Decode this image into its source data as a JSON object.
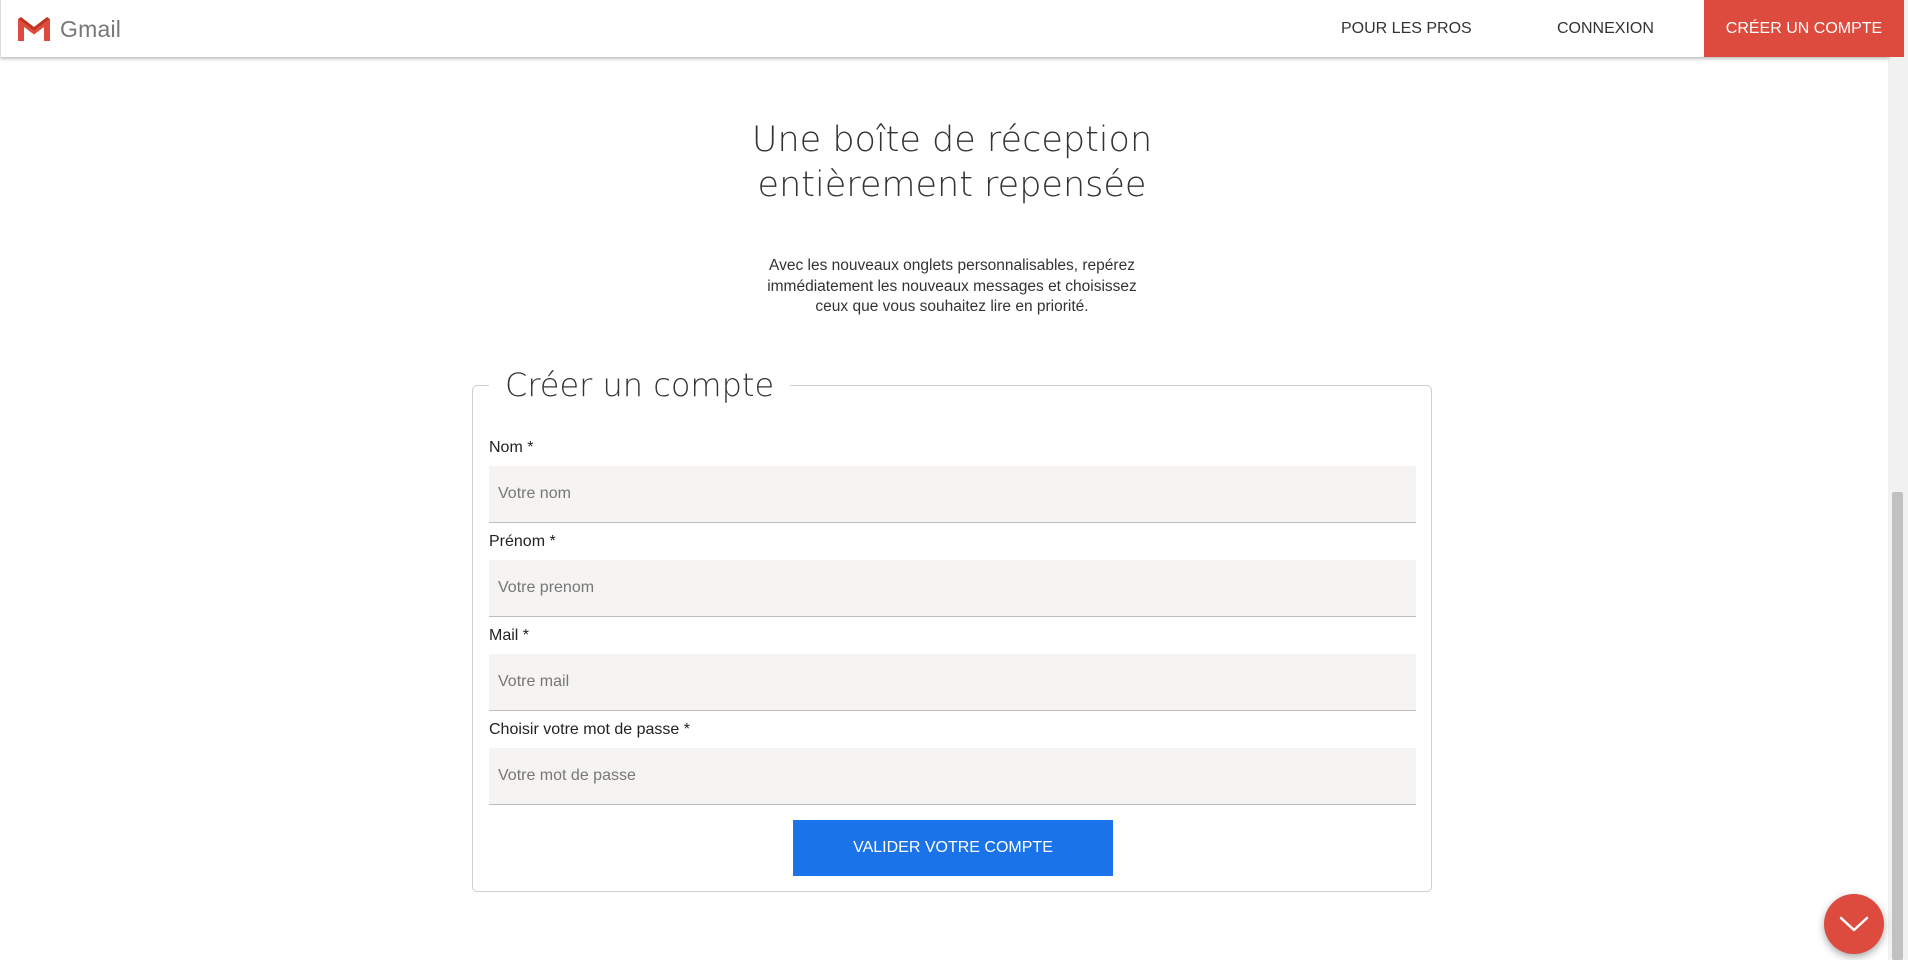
{
  "header": {
    "brand": "Gmail",
    "nav": {
      "pros": "POUR LES PROS",
      "connexion": "CONNEXION",
      "create": "CRÉER UN COMPTE"
    },
    "accent_color": "#dd4b3e"
  },
  "hero": {
    "title_line1": "Une boîte de réception",
    "title_line2": "entièrement repensée",
    "desc_line1": "Avec les nouveaux onglets personnalisables, repérez",
    "desc_line2": "immédiatement les nouveaux messages et choisissez",
    "desc_line3": "ceux que vous souhaitez lire en priorité."
  },
  "form": {
    "legend": "Créer un compte",
    "fields": [
      {
        "label": "Nom *",
        "placeholder": "Votre nom"
      },
      {
        "label": "Prénom *",
        "placeholder": "Votre prenom"
      },
      {
        "label": "Mail *",
        "placeholder": "Votre mail"
      },
      {
        "label": "Choisir votre mot de passe *",
        "placeholder": "Votre mot de passe"
      }
    ],
    "submit_label": "VALIDER VOTRE COMPTE",
    "submit_color": "#1a73e8"
  },
  "fab": {
    "icon": "chevron-down-icon"
  }
}
